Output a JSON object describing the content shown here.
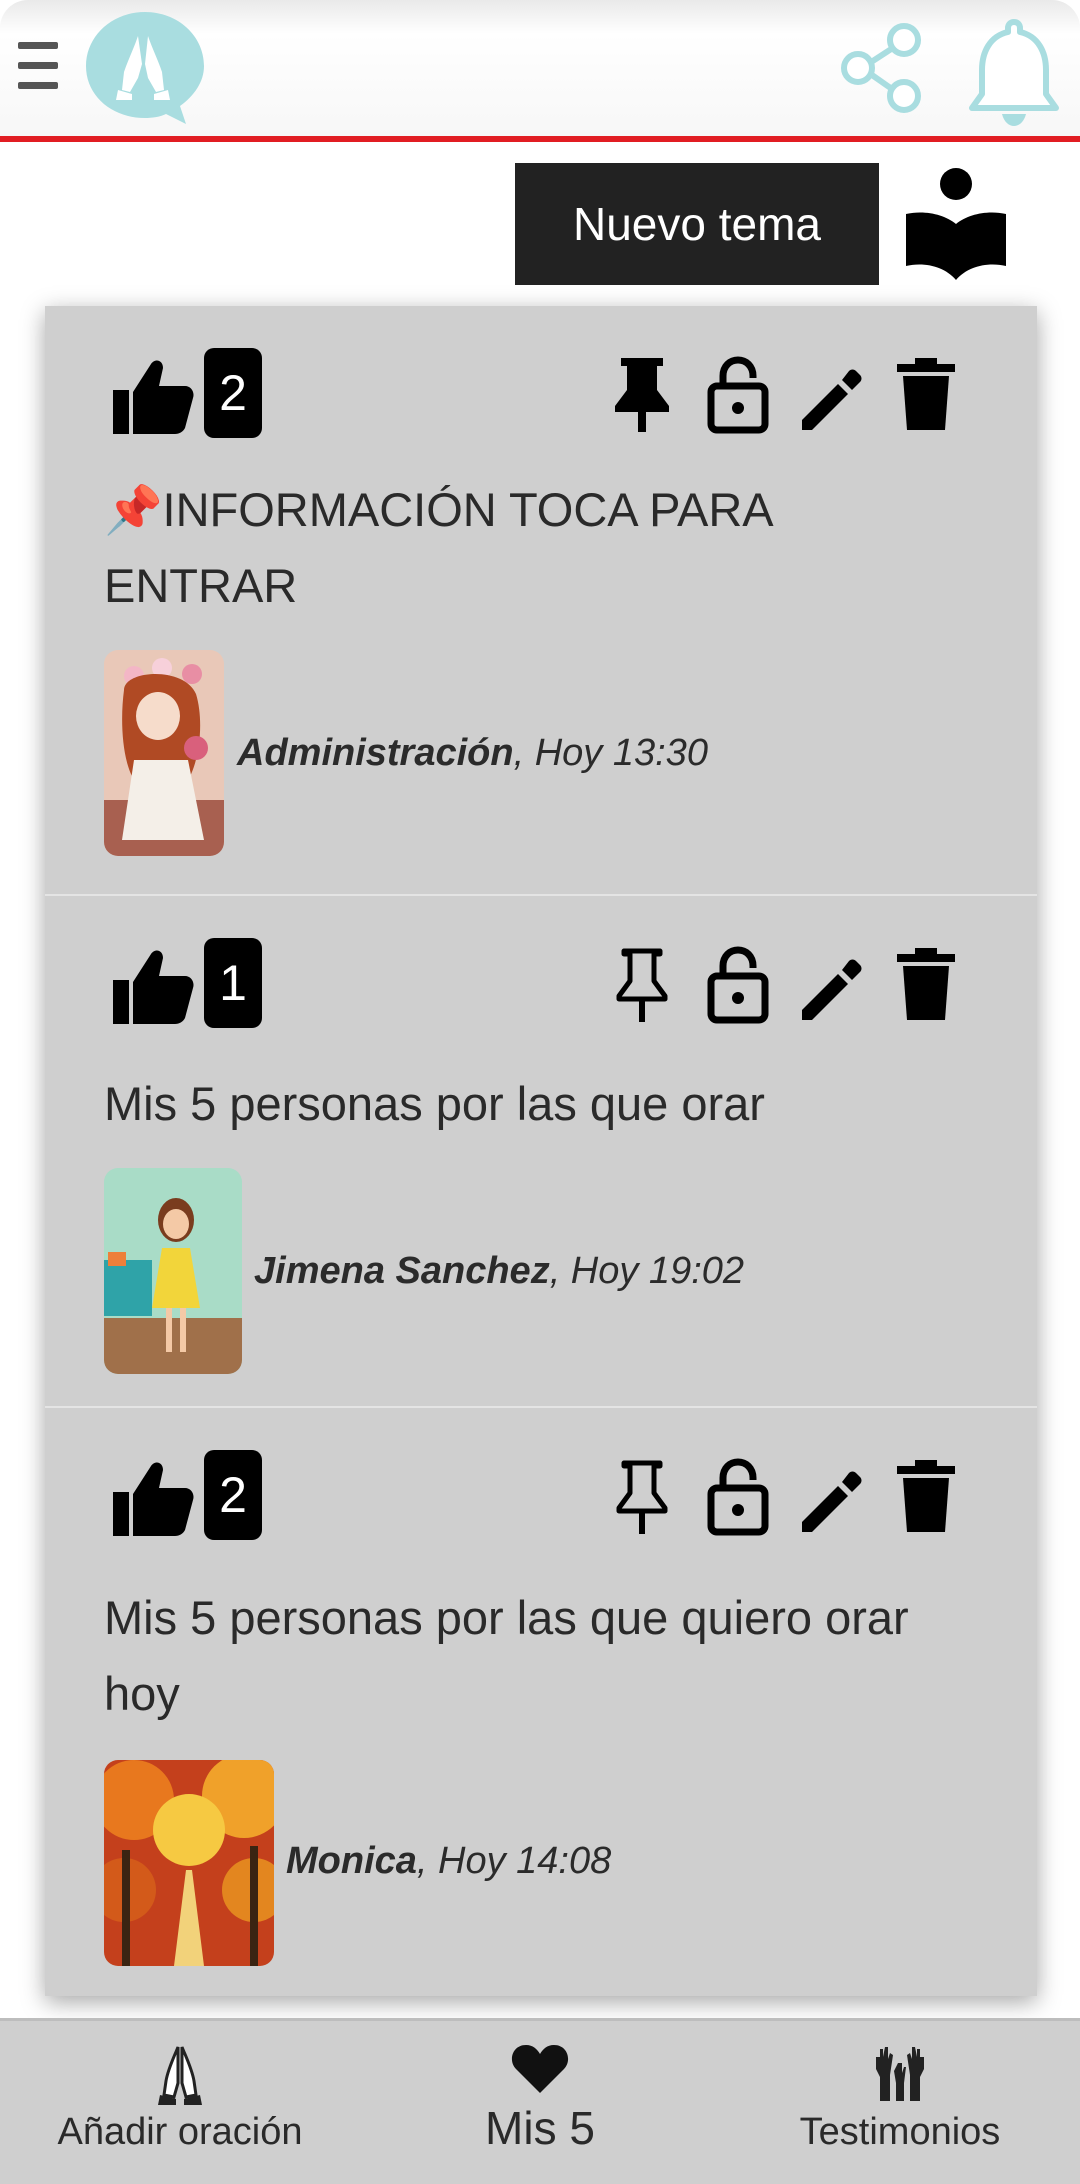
{
  "header": {
    "menu_icon": "hamburger-icon",
    "logo_icon": "praying-hands-logo",
    "share_icon": "share-icon",
    "notifications_icon": "bell-icon",
    "accent_color": "#e11d23",
    "logo_color": "#a9dde0"
  },
  "toolbar": {
    "new_topic_label": "Nuevo tema",
    "reader_icon": "reading-person-icon"
  },
  "topics": [
    {
      "likes": "2",
      "pinned": true,
      "title_prefix": "📌",
      "title": "INFORMACIÓN TOCA PARA ENTRAR",
      "author": "Administración",
      "time": ", Hoy 13:30"
    },
    {
      "likes": "1",
      "pinned": false,
      "title": "Mis 5 personas por las que orar",
      "author": "Jimena Sanchez",
      "time": ", Hoy 19:02"
    },
    {
      "likes": "2",
      "pinned": false,
      "title": "Mis 5 personas por las que quiero orar hoy",
      "author": "Monica",
      "time": ", Hoy 14:08"
    }
  ],
  "bottom_nav": {
    "add_prayer_label": "Añadir oración",
    "mis5_label": "Mis 5",
    "testimonies_label": "Testimonios"
  }
}
